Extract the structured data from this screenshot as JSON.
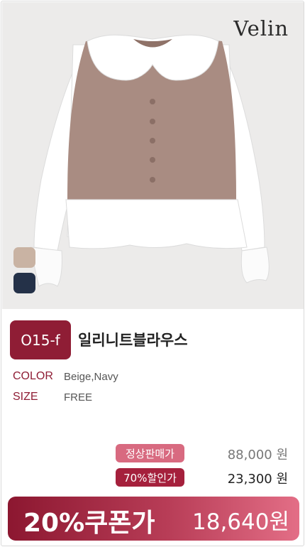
{
  "product": {
    "brand": "Velin",
    "code": "O15-f",
    "name": "일리니트블라우스",
    "swatches": [
      {
        "name": "Beige",
        "color": "#c9b3a3"
      },
      {
        "name": "Navy",
        "color": "#243148"
      }
    ],
    "color_label": "COLOR",
    "color_value": "Beige,Navy",
    "size_label": "SIZE",
    "size_value": "FREE"
  },
  "pricing": {
    "regular_label": "정상판매가",
    "regular_price": "88,000 원",
    "sale_label": "70%할인가",
    "sale_price": "23,300 원",
    "coupon_label": "20%쿠폰가",
    "coupon_price": "18,640원"
  }
}
